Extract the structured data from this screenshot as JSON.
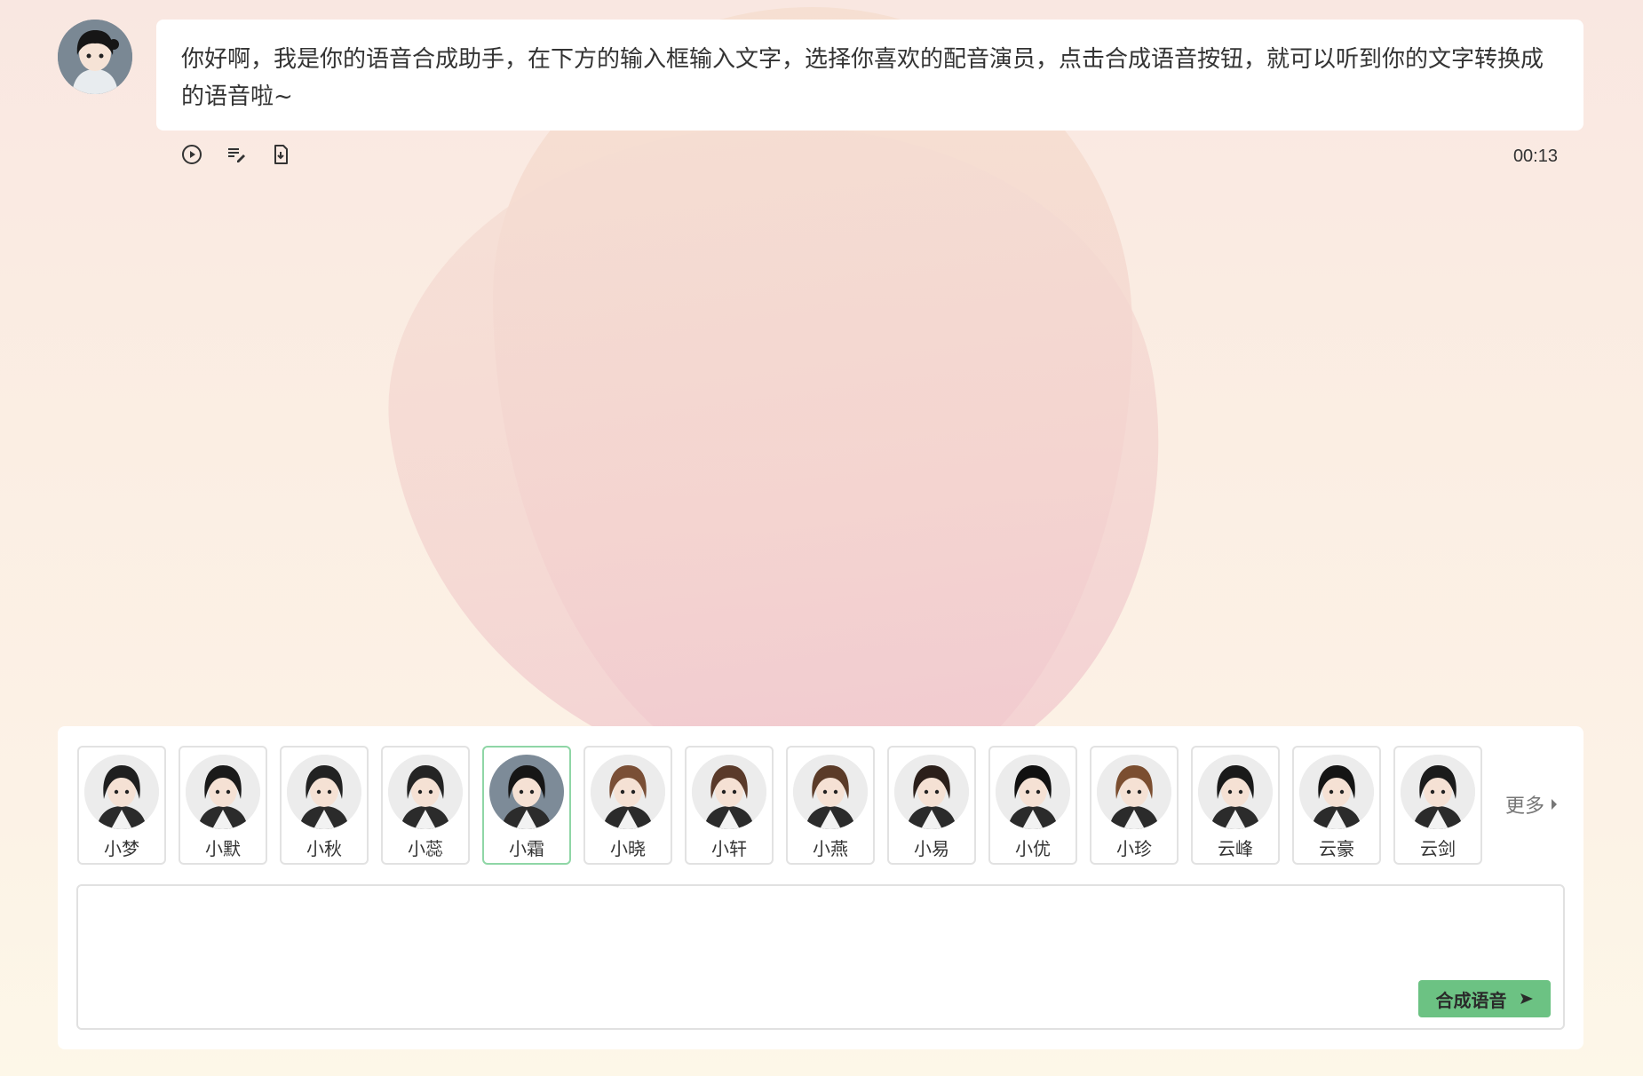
{
  "message": {
    "text": "你好啊，我是你的语音合成助手，在下方的输入框输入文字，选择你喜欢的配音演员，点击合成语音按钮，就可以听到你的文字转换成的语音啦~",
    "duration": "00:13",
    "actions": [
      {
        "icon": "play-icon"
      },
      {
        "icon": "edit-text-icon"
      },
      {
        "icon": "download-file-icon"
      }
    ]
  },
  "voices": [
    {
      "name": "小梦",
      "hair": "#1f1f1f",
      "bg": "#ececec",
      "selected": false
    },
    {
      "name": "小默",
      "hair": "#1a1a1a",
      "bg": "#ececec",
      "selected": false
    },
    {
      "name": "小秋",
      "hair": "#222222",
      "bg": "#ececec",
      "selected": false
    },
    {
      "name": "小蕊",
      "hair": "#242424",
      "bg": "#ececec",
      "selected": false
    },
    {
      "name": "小霜",
      "hair": "#161616",
      "bg": "#7d8b98",
      "selected": true
    },
    {
      "name": "小晓",
      "hair": "#7a4f36",
      "bg": "#ececec",
      "selected": false
    },
    {
      "name": "小轩",
      "hair": "#5a3a2a",
      "bg": "#ececec",
      "selected": false
    },
    {
      "name": "小燕",
      "hair": "#5b3b28",
      "bg": "#ececec",
      "selected": false
    },
    {
      "name": "小易",
      "hair": "#2b1f1a",
      "bg": "#ececec",
      "selected": false
    },
    {
      "name": "小优",
      "hair": "#111111",
      "bg": "#ececec",
      "selected": false
    },
    {
      "name": "小珍",
      "hair": "#7b4e30",
      "bg": "#ececec",
      "selected": false
    },
    {
      "name": "云峰",
      "hair": "#1a1a1a",
      "bg": "#ececec",
      "selected": false
    },
    {
      "name": "云豪",
      "hair": "#151515",
      "bg": "#ececec",
      "selected": false
    },
    {
      "name": "云剑",
      "hair": "#1b1b1b",
      "bg": "#ececec",
      "selected": false
    }
  ],
  "more_label": "更多",
  "input": {
    "value": "",
    "placeholder": ""
  },
  "synth_button": "合成语音",
  "colors": {
    "accent": "#6cc283",
    "selected_border": "#8fd6a6"
  }
}
